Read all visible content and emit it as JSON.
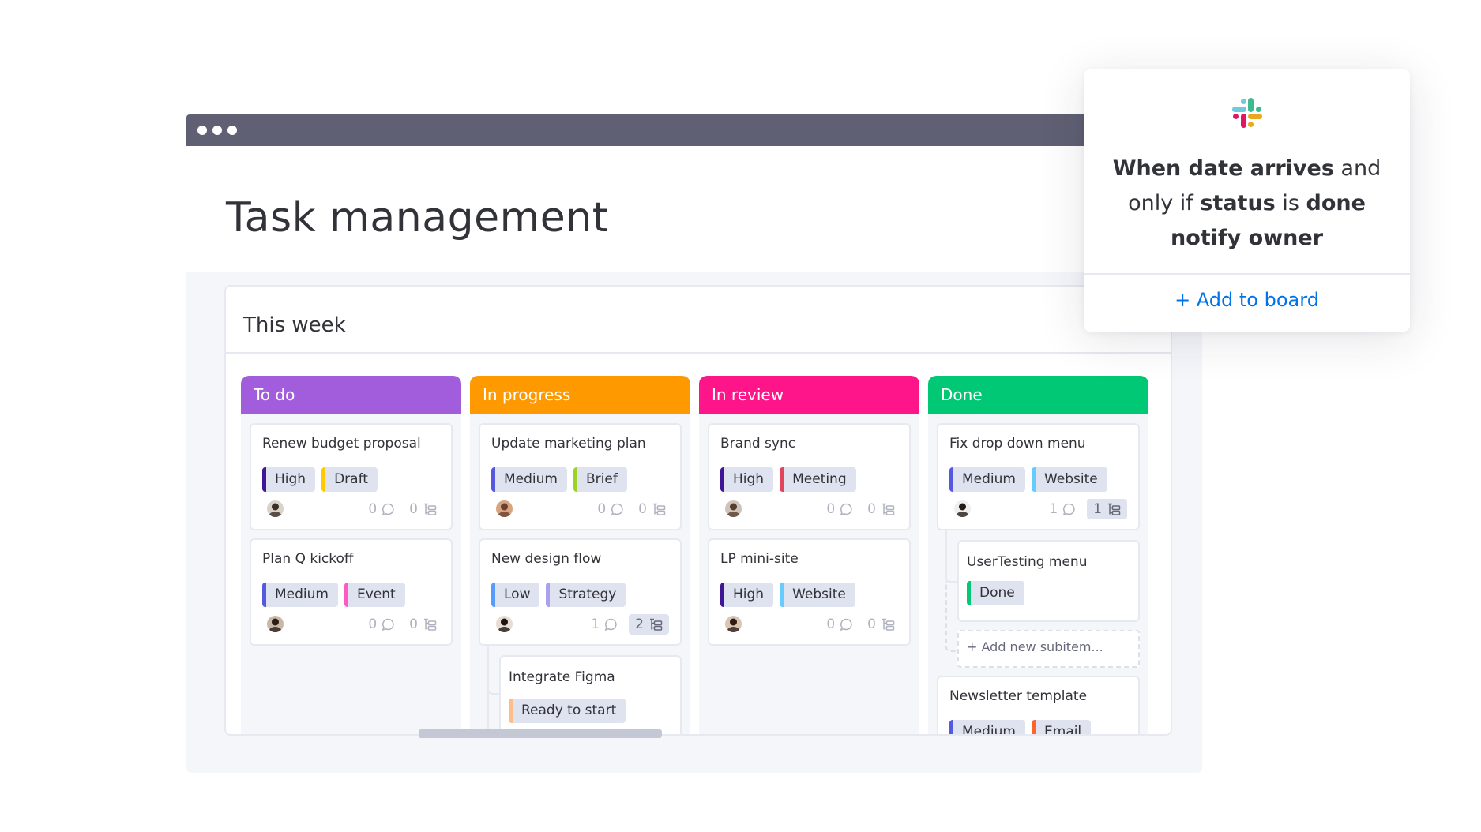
{
  "window": {
    "dots": 3
  },
  "page": {
    "title": "Task management"
  },
  "board": {
    "title": "This  week"
  },
  "colors": {
    "todo": "#a25ddc",
    "in_progress": "#ff9900",
    "in_review": "#ff158a",
    "done": "#00c875",
    "high": "#401694",
    "medium": "#5559df",
    "low": "#579bfc",
    "draft": "#ffcb00",
    "event": "#ff5ac4",
    "brief": "#9cd326",
    "strategy": "#a9a0f0",
    "meeting": "#e2445c",
    "website": "#66ccff",
    "email": "#ff642e",
    "ready": "#ffbd8a",
    "done_tag": "#00c875",
    "link": "#0073ea"
  },
  "columns": [
    {
      "label": "To do",
      "color_key": "todo",
      "cards": [
        {
          "title": "Renew budget proposal",
          "tags": [
            {
              "label": "High",
              "color_key": "high"
            },
            {
              "label": "Draft",
              "color_key": "draft"
            }
          ],
          "comments": "0",
          "subitems": "0",
          "avatar": "person-1"
        },
        {
          "title": "Plan Q kickoff",
          "tags": [
            {
              "label": "Medium",
              "color_key": "medium"
            },
            {
              "label": "Event",
              "color_key": "event"
            }
          ],
          "comments": "0",
          "subitems": "0",
          "avatar": "person-2"
        }
      ]
    },
    {
      "label": "In progress",
      "color_key": "in_progress",
      "cards": [
        {
          "title": "Update marketing plan",
          "tags": [
            {
              "label": "Medium",
              "color_key": "medium"
            },
            {
              "label": "Brief",
              "color_key": "brief"
            }
          ],
          "comments": "0",
          "subitems": "0",
          "avatar": "person-3"
        },
        {
          "title": "New design flow",
          "tags": [
            {
              "label": "Low",
              "color_key": "low"
            },
            {
              "label": "Strategy",
              "color_key": "strategy"
            }
          ],
          "comments": "1",
          "subitems": "2",
          "avatar": "person-4"
        }
      ],
      "subitems": [
        {
          "title": "Integrate Figma",
          "tag": {
            "label": "Ready to start",
            "color_key": "ready"
          }
        }
      ]
    },
    {
      "label": "In review",
      "color_key": "in_review",
      "cards": [
        {
          "title": "Brand sync",
          "tags": [
            {
              "label": "High",
              "color_key": "high"
            },
            {
              "label": "Meeting",
              "color_key": "meeting"
            }
          ],
          "comments": "0",
          "subitems": "0",
          "avatar": "person-5"
        },
        {
          "title": "LP mini-site",
          "tags": [
            {
              "label": "High",
              "color_key": "high"
            },
            {
              "label": "Website",
              "color_key": "website"
            }
          ],
          "comments": "0",
          "subitems": "0",
          "avatar": "person-6"
        }
      ]
    },
    {
      "label": "Done",
      "color_key": "done",
      "cards": [
        {
          "title": "Fix drop down menu",
          "tags": [
            {
              "label": "Medium",
              "color_key": "medium"
            },
            {
              "label": "Website",
              "color_key": "website"
            }
          ],
          "comments": "1",
          "subitems": "1",
          "avatar": "person-7"
        },
        {
          "title": "Newsletter template",
          "tags": [
            {
              "label": "Medium",
              "color_key": "medium"
            },
            {
              "label": "Email",
              "color_key": "email"
            }
          ]
        }
      ],
      "subitems": [
        {
          "title": "UserTesting menu",
          "tag": {
            "label": "Done",
            "color_key": "done_tag"
          }
        }
      ],
      "add_subitem_label": "+ Add new subitem..."
    }
  ],
  "popup": {
    "logo": "slack-logo-icon",
    "line1_bold": "When date arrives",
    "line1_rest": " and",
    "line2_pre": "only if ",
    "line2_bold1": "status",
    "line2_mid": " is ",
    "line2_bold2": "done",
    "line3_bold": "notify owner",
    "action_label": "+ Add to board"
  }
}
